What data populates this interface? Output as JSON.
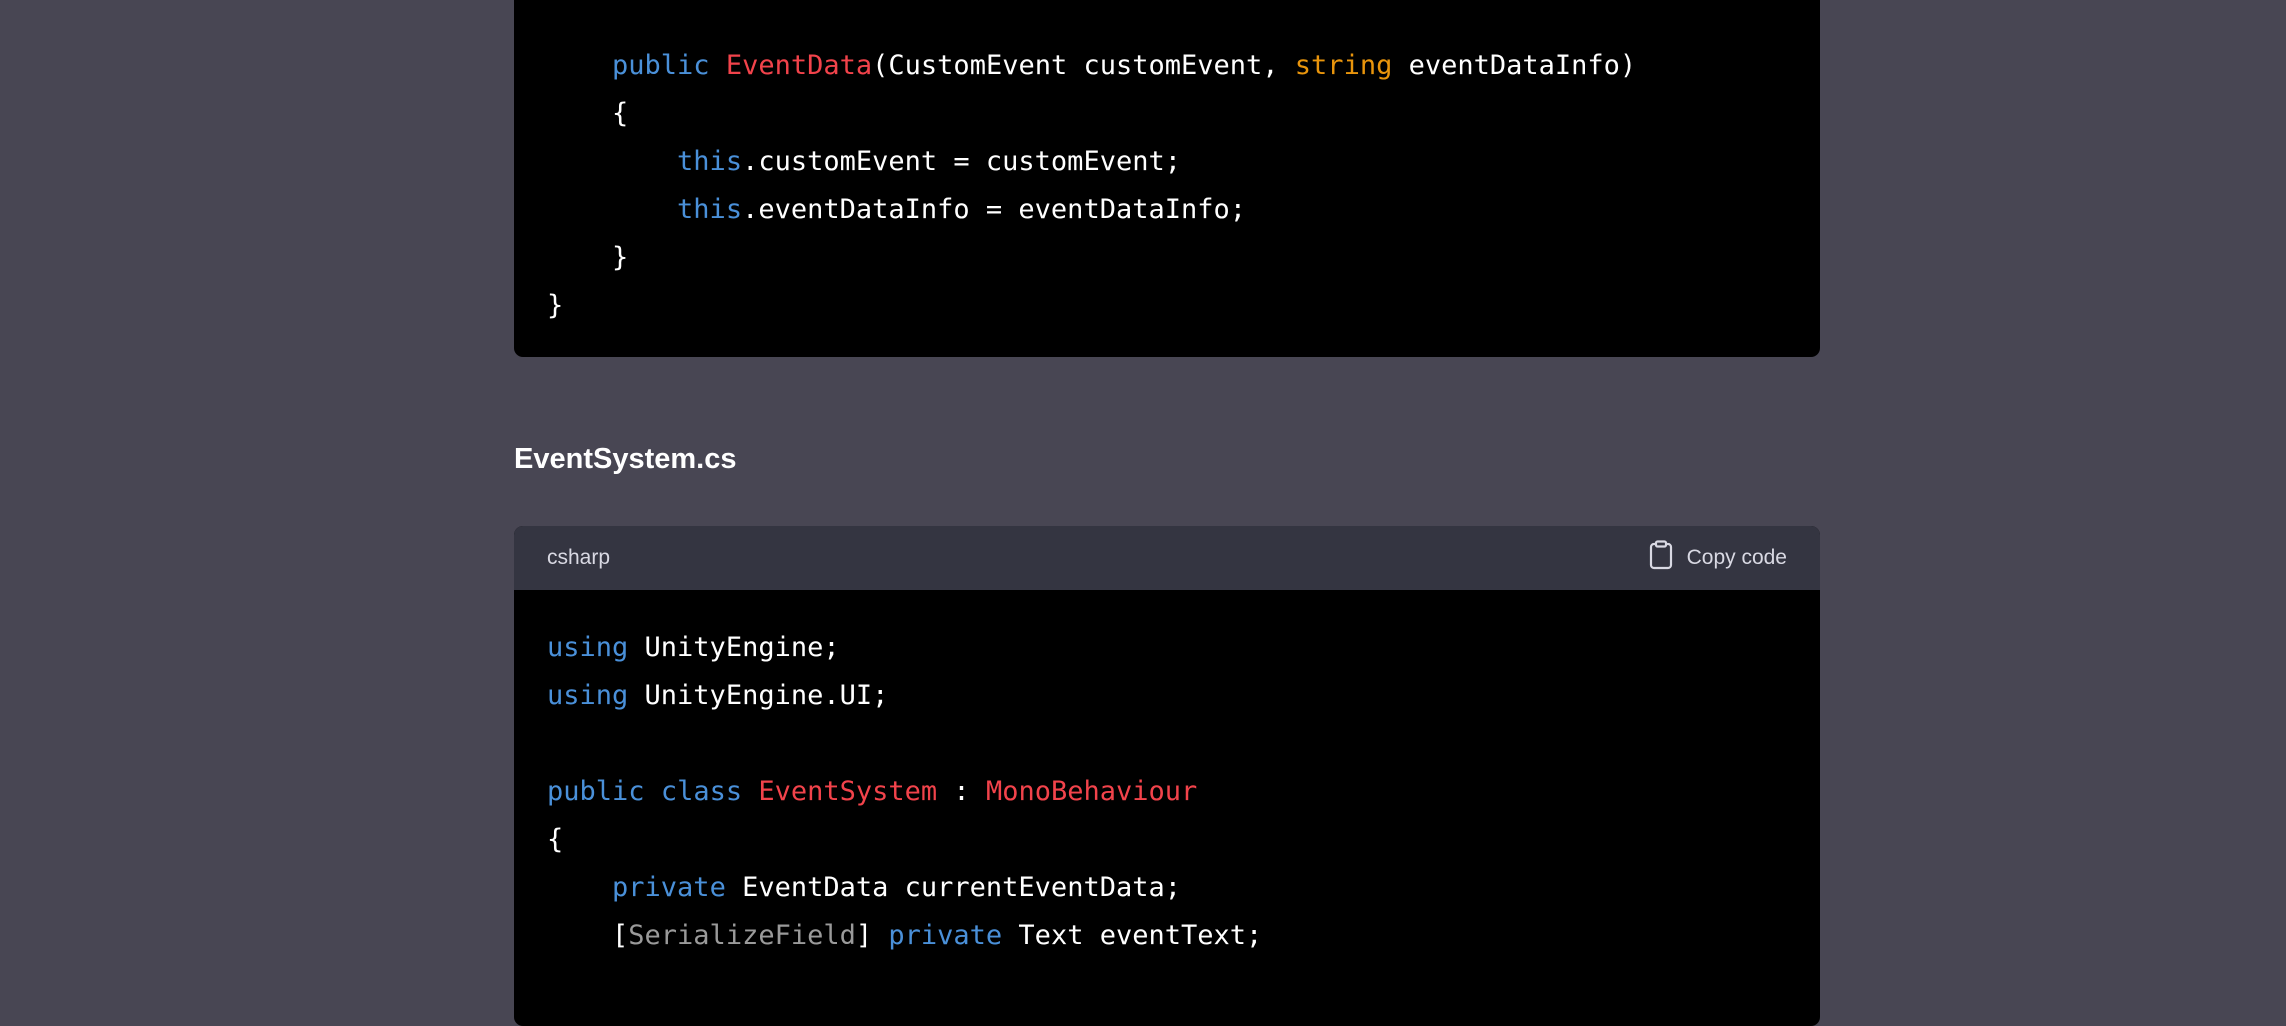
{
  "colors": {
    "background": "#484653",
    "code_bg": "#000000",
    "header_bg": "#343541",
    "keyword": "#4a90d9",
    "title": "#f2434b",
    "builtin": "#e9950c",
    "meta": "#9a9a9a"
  },
  "block1": {
    "lines": [
      [
        {
          "t": "    "
        },
        {
          "t": "public",
          "c": "kw"
        },
        {
          "t": " "
        },
        {
          "t": "EventData",
          "c": "ti"
        },
        {
          "t": "(CustomEvent customEvent, "
        },
        {
          "t": "string",
          "c": "bi"
        },
        {
          "t": " eventDataInfo)"
        }
      ],
      [
        {
          "t": "    {"
        }
      ],
      [
        {
          "t": "        "
        },
        {
          "t": "this",
          "c": "kw"
        },
        {
          "t": ".customEvent = customEvent;"
        }
      ],
      [
        {
          "t": "        "
        },
        {
          "t": "this",
          "c": "kw"
        },
        {
          "t": ".eventDataInfo = eventDataInfo;"
        }
      ],
      [
        {
          "t": "    }"
        }
      ],
      [
        {
          "t": "}"
        }
      ]
    ]
  },
  "heading": "EventSystem.cs",
  "block2": {
    "language": "csharp",
    "copy_label": "Copy code",
    "copy_icon": "clipboard-icon",
    "lines": [
      [
        {
          "t": "using",
          "c": "kw"
        },
        {
          "t": " UnityEngine;"
        }
      ],
      [
        {
          "t": "using",
          "c": "kw"
        },
        {
          "t": " UnityEngine.UI;"
        }
      ],
      [],
      [
        {
          "t": "public",
          "c": "kw"
        },
        {
          "t": " "
        },
        {
          "t": "class",
          "c": "kw"
        },
        {
          "t": " "
        },
        {
          "t": "EventSystem",
          "c": "ti"
        },
        {
          "t": " : "
        },
        {
          "t": "MonoBehaviour",
          "c": "ti"
        }
      ],
      [
        {
          "t": "{"
        }
      ],
      [
        {
          "t": "    "
        },
        {
          "t": "private",
          "c": "kw"
        },
        {
          "t": " EventData currentEventData;"
        }
      ],
      [
        {
          "t": "    ["
        },
        {
          "t": "SerializeField",
          "c": "mt"
        },
        {
          "t": "] "
        },
        {
          "t": "private",
          "c": "kw"
        },
        {
          "t": " Text eventText;"
        }
      ]
    ]
  }
}
